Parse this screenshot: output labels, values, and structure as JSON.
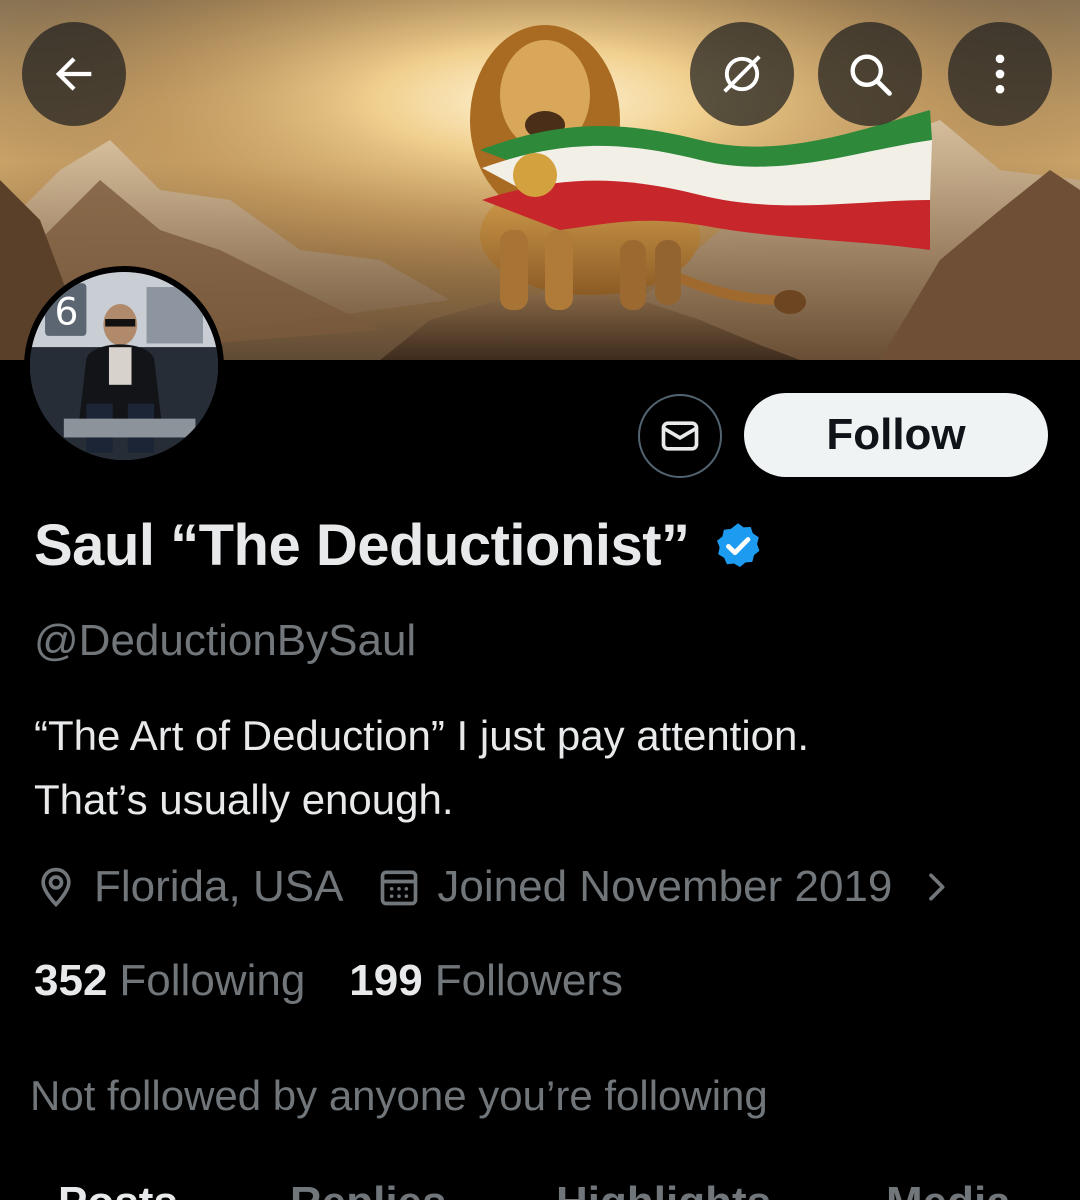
{
  "header": {
    "back_icon": "arrow-left-icon",
    "buttons": [
      {
        "name": "unfollow-slash-icon"
      },
      {
        "name": "search-icon"
      },
      {
        "name": "more-vertical-icon"
      }
    ]
  },
  "profile": {
    "display_name": "Saul “The Deductionist”",
    "verified": true,
    "handle": "@DeductionBySaul",
    "bio_line1": "“The Art of Deduction” I just pay attention.",
    "bio_line2": "That’s usually enough.",
    "location": "Florida, USA",
    "joined": "Joined November 2019",
    "following_count": "352",
    "following_label": "Following",
    "followers_count": "199",
    "followers_label": "Followers",
    "mutuals_text": "Not followed by anyone you’re following"
  },
  "actions": {
    "follow_label": "Follow",
    "message_icon": "envelope-icon"
  },
  "tabs": [
    {
      "label": "Posts",
      "active": true
    },
    {
      "label": "Replies",
      "active": false
    },
    {
      "label": "Highlights",
      "active": false
    },
    {
      "label": "Media",
      "active": false
    }
  ],
  "colors": {
    "background": "#000000",
    "primary_text": "#e7e9ea",
    "secondary_text": "#71767b",
    "verified_blue": "#1d9bf0",
    "follow_button_bg": "#eff3f4"
  }
}
